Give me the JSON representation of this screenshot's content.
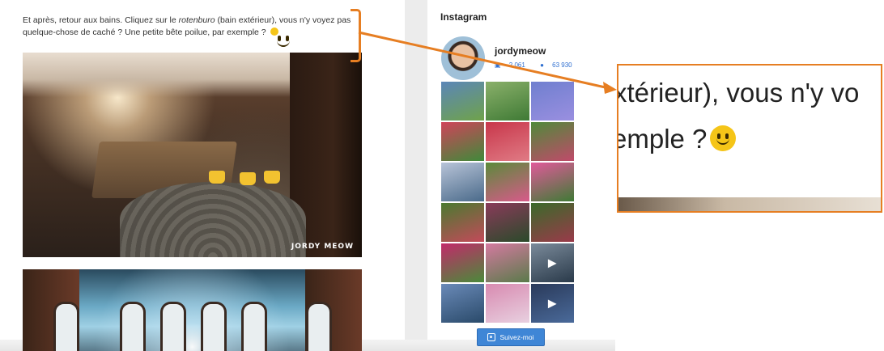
{
  "article": {
    "intro_part1": "Et après, retour aux bains. Cliquez sur le ",
    "intro_em": "rotenburo",
    "intro_part2": " (bain extérieur), vous n'y voyez pas quelque-chose de caché ? Une petite bête poilue, par exemple ?",
    "smiley_icon": "slightly-smiling-face-icon",
    "photo1_watermark": "JORDY MEOW"
  },
  "instagram": {
    "title": "Instagram",
    "username": "jordymeow",
    "posts_count": "2 061",
    "followers_count": "63 930",
    "follow_label": "Suivez-moi",
    "grid": [
      {
        "c1": "#5b86b8",
        "c2": "#6fa24a"
      },
      {
        "c1": "#8ab06a",
        "c2": "#3f7a35"
      },
      {
        "c1": "#6f7fcf",
        "c2": "#9a8fe0"
      },
      {
        "c1": "#d0435a",
        "c2": "#3f8a3a"
      },
      {
        "c1": "#c8364a",
        "c2": "#e07b85"
      },
      {
        "c1": "#4f8a3a",
        "c2": "#c04a6a"
      },
      {
        "c1": "#b8c4d8",
        "c2": "#4a6a8a"
      },
      {
        "c1": "#5a8a3a",
        "c2": "#d85a8a"
      },
      {
        "c1": "#e15a9a",
        "c2": "#3f7a35"
      },
      {
        "c1": "#4a7a30",
        "c2": "#c34a5a"
      },
      {
        "c1": "#8a3a5a",
        "c2": "#2a4a2a"
      },
      {
        "c1": "#3a6a2a",
        "c2": "#9a3a4a"
      },
      {
        "c1": "#c22a6a",
        "c2": "#4a8a3a"
      },
      {
        "c1": "#d47aa0",
        "c2": "#5a7a4a"
      },
      {
        "c1": "#7a8a9a",
        "c2": "#2a3a4a",
        "play": true
      },
      {
        "c1": "#6a8ab8",
        "c2": "#2a4a6a"
      },
      {
        "c1": "#d88ab0",
        "c2": "#e8d0e0"
      },
      {
        "c1": "#2a3a5a",
        "c2": "#4a6a9a",
        "play": true
      }
    ]
  },
  "zoom": {
    "line1": "xtérieur), vous n'y vo",
    "line2": "emple ?",
    "smiley_icon": "slightly-smiling-face-icon"
  },
  "annotation": {
    "accent": "#e67e22"
  }
}
